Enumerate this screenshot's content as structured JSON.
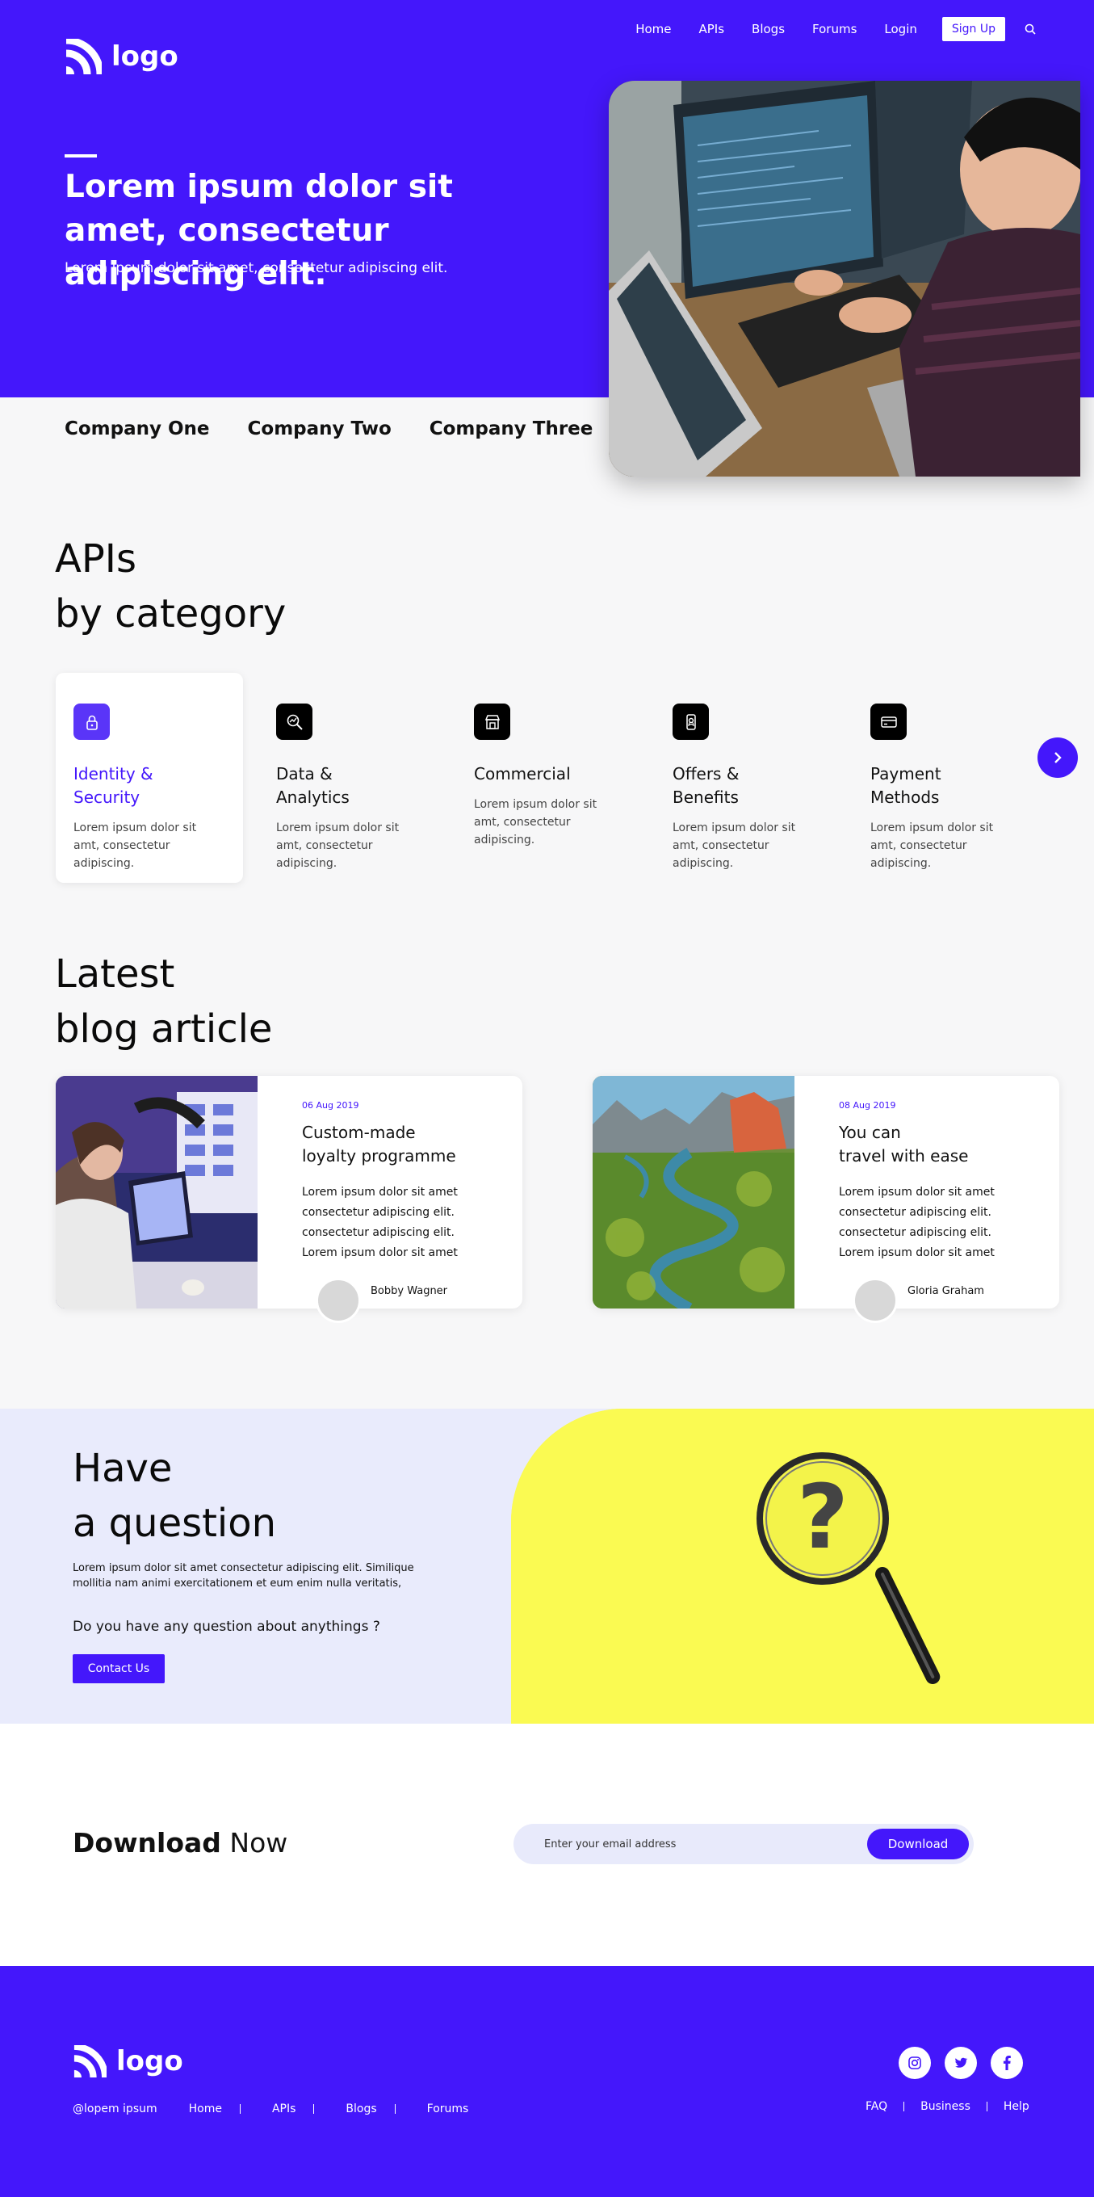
{
  "header": {
    "logo_text": "logo",
    "nav": [
      "Home",
      "APIs",
      "Blogs",
      "Forums",
      "Login"
    ],
    "signup_label": "Sign Up"
  },
  "hero": {
    "title": "Lorem ipsum dolor sit amet, consectetur adipiscing elit.",
    "subtitle": "Lorem ipsum dolor sit amet, consectetur adipiscing elit."
  },
  "companies": [
    "Company One",
    "Company Two",
    "Company Three"
  ],
  "apis": {
    "title_line1": "APIs",
    "title_line2": "by category",
    "categories": [
      {
        "name_line1": "Identity &",
        "name_line2": "Security",
        "desc": "Lorem ipsum dolor sit amt, consectetur adipiscing.",
        "icon": "lock-icon"
      },
      {
        "name_line1": "Data &",
        "name_line2": "Analytics",
        "desc": "Lorem ipsum dolor sit amt, consectetur adipiscing.",
        "icon": "magnifier-chart-icon"
      },
      {
        "name_line1": "Commercial",
        "name_line2": "",
        "desc": "Lorem ipsum dolor sit amt, consectetur adipiscing.",
        "icon": "storefront-icon"
      },
      {
        "name_line1": "Offers &",
        "name_line2": "Benefits",
        "desc": "Lorem ipsum dolor sit amt, consectetur adipiscing.",
        "icon": "phone-offer-icon"
      },
      {
        "name_line1": "Payment",
        "name_line2": "Methods",
        "desc": "Lorem ipsum dolor sit amt, consectetur adipiscing.",
        "icon": "card-icon"
      }
    ]
  },
  "blog": {
    "title_line1": "Latest",
    "title_line2": "blog article",
    "articles": [
      {
        "date": "06 Aug 2019",
        "title_line1": "Custom-made",
        "title_line2": "loyalty programme",
        "body": "Lorem ipsum dolor sit amet consectetur adipiscing elit. consectetur adipiscing elit. Lorem ipsum dolor sit amet",
        "author": "Bobby Wagner"
      },
      {
        "date": "08 Aug 2019",
        "title_line1": "You can",
        "title_line2": "travel with ease",
        "body": "Lorem ipsum dolor sit amet consectetur adipiscing elit. consectetur adipiscing elit. Lorem ipsum dolor sit amet",
        "author": "Gloria Graham"
      }
    ]
  },
  "question": {
    "title_line1": "Have",
    "title_line2": "a question",
    "description": "Lorem ipsum dolor sit amet consectetur adipiscing elit. Similique mollitia nam animi exercitationem et eum enim nulla veritatis,",
    "prompt": "Do you have any question about anythings ?",
    "contact_label": "Contact Us"
  },
  "download": {
    "title_bold": "Download",
    "title_rest": "Now",
    "email_placeholder": "Enter your email address",
    "button_label": "Download"
  },
  "footer": {
    "logo_text": "logo",
    "copyright": "@lopem ipsum",
    "links": [
      "Home",
      "APIs",
      "Blogs",
      "Forums"
    ],
    "right_links": [
      "FAQ",
      "Business",
      "Help"
    ],
    "social": [
      "instagram-icon",
      "twitter-icon",
      "facebook-icon"
    ]
  },
  "colors": {
    "brand": "#4417fb",
    "accent_yellow": "#fafa52",
    "light_bg": "#e9ebfc"
  }
}
